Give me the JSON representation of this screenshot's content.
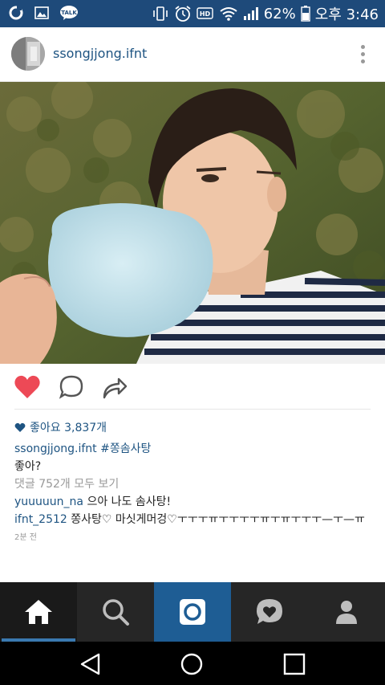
{
  "status_bar": {
    "battery": "62%",
    "time": "오후 3:46",
    "left_icons": [
      "o-app-icon",
      "gallery-icon",
      "kakaotalk-icon"
    ],
    "kakaotalk_label": "TALK",
    "right_icons": [
      "vibrate-icon",
      "alarm-icon",
      "hd-voice-icon",
      "wifi-icon",
      "signal-icon",
      "battery-icon"
    ],
    "hd_label": "HD"
  },
  "post": {
    "username": "ssongjjong.ifnt",
    "likes": "좋아요 3,837개",
    "caption_user": "ssongjjong.ifnt",
    "caption_tag": "#쫑솜사탕",
    "caption_line2": "좋아?",
    "view_comments": "댓글 752개 모두 보기",
    "comments": [
      {
        "user": "yuuuuun_na",
        "text": "으아 나도 솜사탕!"
      },
      {
        "user": "ifnt_2512",
        "text": "쫑사탕♡ 마싯게머겅♡ㅜㅜㅜㅠㅜㅜㅜㅜㅠㅜㅠㅜㅜㅜ—ㅜ—ㅠ"
      }
    ],
    "timestamp": "2분 전"
  },
  "colors": {
    "status_bar": "#1e4a7a",
    "link_blue": "#1e5482",
    "like_red": "#ed4956",
    "nav_bg": "#262626",
    "nav_camera": "#1e5d94"
  },
  "bottom_nav": [
    "home-icon",
    "search-icon",
    "camera-icon",
    "activity-heart-icon",
    "profile-icon"
  ],
  "system_nav": [
    "back-icon",
    "home-circle-icon",
    "recents-icon"
  ]
}
